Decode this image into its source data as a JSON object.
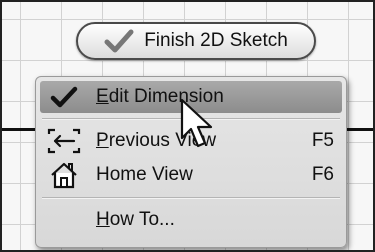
{
  "finish_button": {
    "label": "Finish 2D Sketch",
    "icon": "checkmark-icon"
  },
  "menu": {
    "items": [
      {
        "mnemonic": "E",
        "rest": "dit Dimension",
        "shortcut": "",
        "icon": "checkmark-icon"
      },
      {
        "before": "",
        "mnemonic": "P",
        "rest": "revious View",
        "shortcut": "F5",
        "icon": "previous-view-icon"
      },
      {
        "before": "",
        "mnemonic": "",
        "rest": "Home View",
        "shortcut": "F6",
        "icon": "home-icon"
      },
      {
        "mnemonic": "H",
        "rest": "ow To...",
        "shortcut": "",
        "icon": ""
      }
    ]
  },
  "colors": {
    "highlight": "#9c9c9c",
    "menu_background": "#e0e0e0",
    "sketch_line": "#111111"
  }
}
